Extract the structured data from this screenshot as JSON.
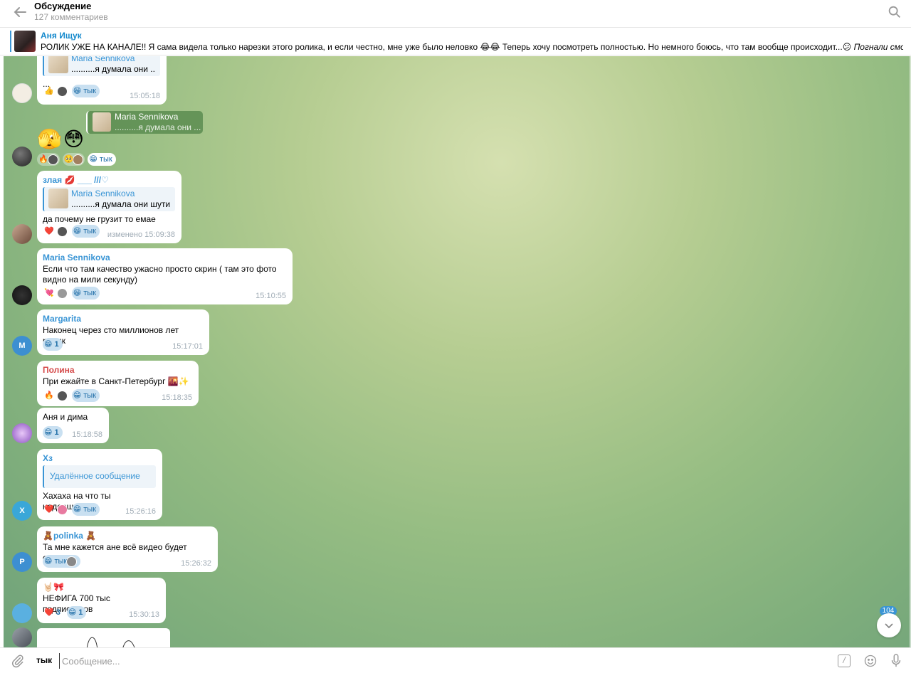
{
  "header": {
    "title": "Обсуждение",
    "subtitle": "127 комментариев"
  },
  "pinned": {
    "author": "Аня Ищук",
    "text": "РОЛИК УЖЕ НА КАНАЛЕ!!  Я сама видела только нарезки этого ролика, и если честно, мне уже было неловко 😂😂 Теперь хочу посмотреть полностью. Но немного боюсь, что там вообще происходит...😕  ",
    "italic": "Погнали смотр..."
  },
  "messages": [
    {
      "reply_name": "Maria Sennikova",
      "reply_text": "..........я думала они ...",
      "text": "...",
      "time": "15:05:18",
      "reactions": [
        "👍",
        "😁 тык"
      ]
    },
    {
      "reply_name": "Maria Sennikova",
      "reply_text": "..........я думала они ...",
      "emoji": "🫣😳",
      "reactions": [
        "🔥",
        "🥺",
        "😁 тык"
      ]
    },
    {
      "author": "злая 💋 ___ ///♡",
      "reply_name": "Maria Sennikova",
      "reply_text": "..........я думала они шути...",
      "text": "да почему не грузит то емае",
      "time": "изменено 15:09:38",
      "reactions": [
        "❤️",
        "😁 тык"
      ]
    },
    {
      "author": "Maria Sennikova",
      "text": "Если что там качество ужасно просто скрин ( там это фото видно на мили секунду)",
      "time": "15:10:55",
      "reactions": [
        "💘",
        "😁 тык"
      ]
    },
    {
      "author": "Margarita",
      "text": "Наконец через сто миллионов лет ролик",
      "time": "15:17:01",
      "reactions": [
        "😁",
        "1"
      ],
      "avatar_letter": "M"
    },
    {
      "author": "Полина",
      "text": "При ежайте в Санкт-Петербург 🌇✨",
      "time": "15:18:35",
      "reactions": [
        "🔥",
        "😁 тык"
      ]
    },
    {
      "text": "Аня и дима",
      "time": "15:18:58",
      "reactions": [
        "😁",
        "1"
      ]
    },
    {
      "author": "Хз",
      "reply_text": "Удалённое сообщение",
      "text": "Хахаха на что ты надеешься?",
      "time": "15:26:16",
      "reactions": [
        "❤️",
        "😁 тык"
      ],
      "avatar_letter": "X"
    },
    {
      "author": "🧸polinka 🧸",
      "text": "Та мне кажется ане всё видео будет стыдно",
      "time": "15:26:32",
      "reactions": [
        "😁 тык"
      ],
      "avatar_letter": "P"
    },
    {
      "author": "🤘🏻🎀",
      "text": "НЕФИГА 700 тыс подписчиков",
      "time": "15:30:13",
      "reactions": [
        "❤️",
        "3",
        "😁",
        "1"
      ]
    }
  ],
  "scroll": {
    "badge": "104"
  },
  "composer": {
    "send_as": "тык",
    "placeholder": "Сообщение..."
  },
  "colors": {
    "accent": "#3a95d5",
    "author_red": "#d54a4a",
    "author_green": "#3d9e4a"
  },
  "icons": [
    "back-arrow-icon",
    "search-icon",
    "attach-icon",
    "command-icon",
    "emoji-icon",
    "microphone-icon",
    "chevron-down-icon"
  ]
}
